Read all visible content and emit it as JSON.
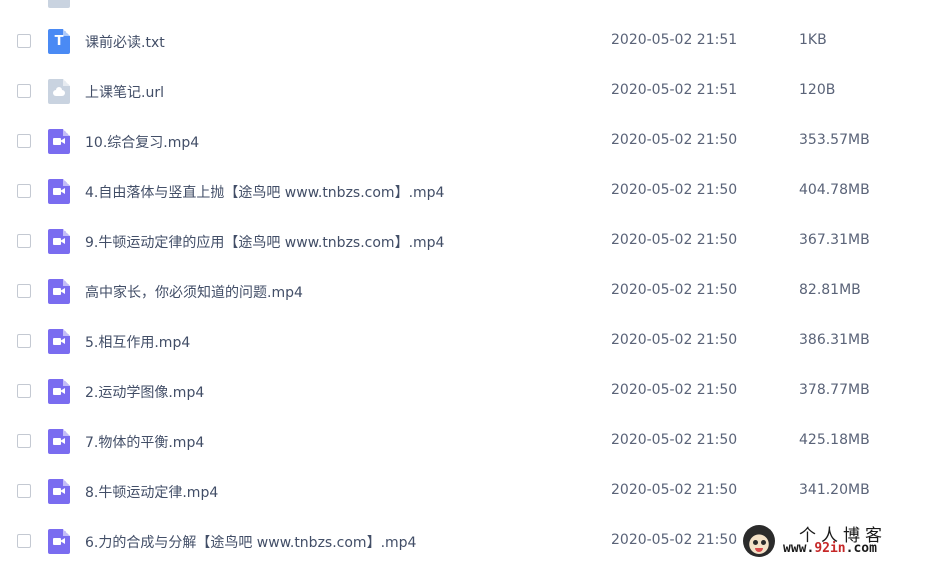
{
  "files": [
    {
      "name": "课前必读.txt",
      "date": "2020-05-02 21:51",
      "size": "1KB",
      "type": "txt",
      "icon": "document-text-icon"
    },
    {
      "name": "上课笔记.url",
      "date": "2020-05-02 21:51",
      "size": "120B",
      "type": "url",
      "icon": "cloud-link-icon"
    },
    {
      "name": "10.综合复习.mp4",
      "date": "2020-05-02 21:50",
      "size": "353.57MB",
      "type": "video",
      "icon": "video-file-icon"
    },
    {
      "name": "4.自由落体与竖直上抛【途鸟吧 www.tnbzs.com】.mp4",
      "date": "2020-05-02 21:50",
      "size": "404.78MB",
      "type": "video",
      "icon": "video-file-icon"
    },
    {
      "name": "9.牛顿运动定律的应用【途鸟吧 www.tnbzs.com】.mp4",
      "date": "2020-05-02 21:50",
      "size": "367.31MB",
      "type": "video",
      "icon": "video-file-icon"
    },
    {
      "name": "高中家长，你必须知道的问题.mp4",
      "date": "2020-05-02 21:50",
      "size": "82.81MB",
      "type": "video",
      "icon": "video-file-icon"
    },
    {
      "name": "5.相互作用.mp4",
      "date": "2020-05-02 21:50",
      "size": "386.31MB",
      "type": "video",
      "icon": "video-file-icon"
    },
    {
      "name": "2.运动学图像.mp4",
      "date": "2020-05-02 21:50",
      "size": "378.77MB",
      "type": "video",
      "icon": "video-file-icon"
    },
    {
      "name": "7.物体的平衡.mp4",
      "date": "2020-05-02 21:50",
      "size": "425.18MB",
      "type": "video",
      "icon": "video-file-icon"
    },
    {
      "name": "8.牛顿运动定律.mp4",
      "date": "2020-05-02 21:50",
      "size": "341.20MB",
      "type": "video",
      "icon": "video-file-icon"
    },
    {
      "name": "6.力的合成与分解【途鸟吧 www.tnbzs.com】.mp4",
      "date": "2020-05-02 21:50",
      "size": "",
      "type": "video",
      "icon": "video-file-icon"
    }
  ],
  "icon_glyphs": {
    "txt": "T"
  },
  "watermark": {
    "title": "个人博客",
    "url_prefix": "www.",
    "url_mid": "92in",
    "url_suffix": ".com"
  },
  "colors": {
    "video_icon": "#7a6cf0",
    "txt_icon": "#4a8af4",
    "url_icon": "#c9d3e0",
    "text": "#424e67"
  }
}
